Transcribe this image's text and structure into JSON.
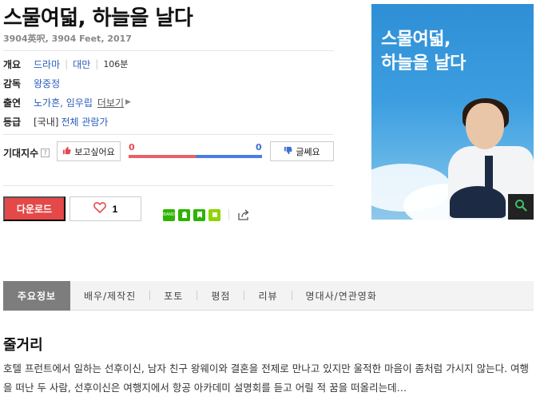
{
  "movie": {
    "title": "스물여덟, 하늘을 날다",
    "original_title": "3904英呎, 3904 Feet, 2017"
  },
  "info": {
    "overview_label": "개요",
    "genre": "드라마",
    "country": "대만",
    "runtime": "106분",
    "director_label": "감독",
    "director": "왕중정",
    "cast_label": "출연",
    "cast": "노가흔, 임우립",
    "more_label": "더보기",
    "rating_label": "등급",
    "rating_prefix": "[국내]",
    "rating": "전체 관람가"
  },
  "expectation": {
    "label": "기대지수",
    "help_icon": "?",
    "like_label": "보고싶어요",
    "dislike_label": "글쎄요",
    "like_count": "0",
    "dislike_count": "0",
    "like_color": "#e8606a",
    "dislike_color": "#4a7fe0"
  },
  "actions": {
    "download_label": "다운로드",
    "like_count": "1",
    "band_label": "BAND"
  },
  "poster": {
    "title_line1": "스물여덟,",
    "title_line2": "하늘을 날다"
  },
  "tabs": [
    {
      "label": "주요정보"
    },
    {
      "label": "배우/제작진"
    },
    {
      "label": "포토"
    },
    {
      "label": "평점"
    },
    {
      "label": "리뷰"
    },
    {
      "label": "명대사/연관영화"
    }
  ],
  "synopsis": {
    "title": "줄거리",
    "text": "호텔 프런트에서 일하는 선후이신, 남자 친구 왕웨이와 결혼을 전제로 만나고 있지만 울적한 마음이 좀처럼 가시지 않는다. 여행을 떠난 두 사람, 선후이신은 여행지에서 항공 아카데미 설명회를 듣고 어릴 적 꿈을 떠올리는데…"
  }
}
